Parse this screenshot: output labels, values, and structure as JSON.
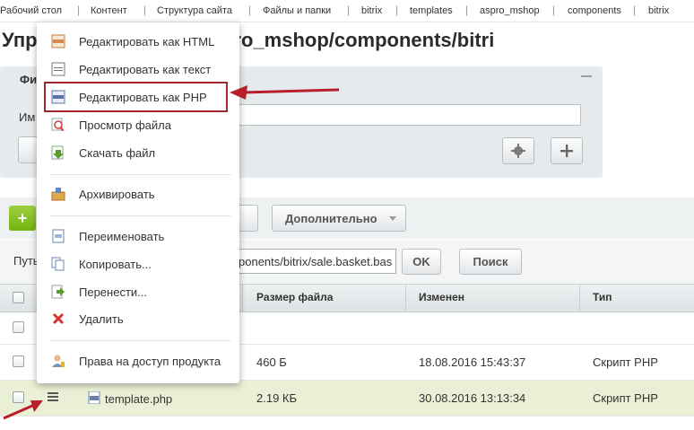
{
  "breadcrumb": [
    "Рабочий стол",
    "Контент",
    "Структура сайта",
    "Файлы и папки",
    "bitrix",
    "templates",
    "aspro_mshop",
    "components",
    "bitrix"
  ],
  "breadcrumb_separator": "|",
  "page_title": "Упр /bitrix/templates/aspro_mshop/components/bitri",
  "filter": {
    "tab_label": "Фи",
    "name_label": "Им"
  },
  "toolbar": {
    "add_symbol": "+",
    "more_label": "Дополнительно"
  },
  "path_row": {
    "label": "Путь",
    "path_value": "ponents/bitrix/sale.basket.bas",
    "ok_label": "OK",
    "search_label": "Поиск"
  },
  "table": {
    "columns": [
      "Размер файла",
      "Изменен",
      "Тип"
    ],
    "rows": [
      {
        "name": "",
        "size": "",
        "modified": "",
        "type": ""
      },
      {
        "name": "",
        "size": "460 Б",
        "modified": "18.08.2016 15:43:37",
        "type": "Скрипт PHP"
      },
      {
        "name": "template.php",
        "size": "2.19 КБ",
        "modified": "30.08.2016 13:13:34",
        "type": "Скрипт PHP"
      }
    ]
  },
  "context_menu": {
    "items": [
      {
        "label": "Редактировать как HTML",
        "icon": "html-file-icon"
      },
      {
        "label": "Редактировать как текст",
        "icon": "txt-file-icon"
      },
      {
        "label": "Редактировать как PHP",
        "icon": "php-file-icon"
      },
      {
        "label": "Просмотр файла",
        "icon": "magnifier-icon"
      },
      {
        "label": "Скачать файл",
        "icon": "download-icon"
      },
      {
        "label": "Архивировать",
        "icon": "archive-box-icon"
      },
      {
        "label": "Переименовать",
        "icon": "rename-icon"
      },
      {
        "label": "Копировать...",
        "icon": "copy-icon"
      },
      {
        "label": "Перенести...",
        "icon": "move-icon"
      },
      {
        "label": "Удалить",
        "icon": "delete-x-icon"
      },
      {
        "label": "Права на доступ продукта",
        "icon": "user-access-icon"
      }
    ]
  },
  "colors": {
    "annotation_red": "#b81f2a",
    "add_button_green": "#74b30e"
  }
}
